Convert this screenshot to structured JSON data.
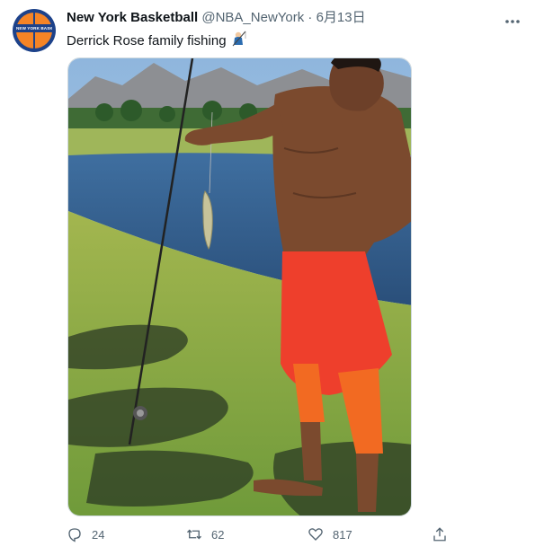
{
  "account": {
    "display_name": "New York Basketball",
    "handle": "@NBA_NewYork",
    "separator": "·",
    "date": "6月13日",
    "avatar_text": "NEW YORK BASKETBALL"
  },
  "tweet": {
    "text": "Derrick Rose family fishing",
    "emoji_icon": "fishing-pole-icon"
  },
  "media": {
    "icons": [
      "video-frame"
    ]
  },
  "actions": {
    "reply_count": "24",
    "retweet_count": "62",
    "like_count": "817"
  },
  "colors": {
    "brand_blue": "#1d428a",
    "brand_orange": "#f58426",
    "secondary_text": "#536471"
  }
}
